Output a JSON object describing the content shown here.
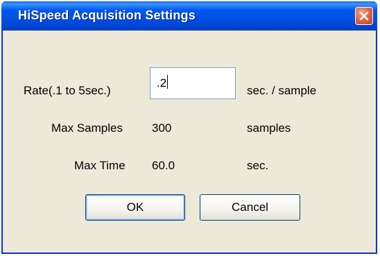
{
  "window": {
    "title": "HiSpeed Acquisition Settings",
    "close_icon": "close-icon"
  },
  "form": {
    "rate_label": "Rate(.1 to 5sec.)",
    "rate_value": ".2",
    "rate_unit": "sec. / sample",
    "max_samples_label": "Max Samples",
    "max_samples_value": "300",
    "max_samples_unit": "samples",
    "max_time_label": "Max Time",
    "max_time_value": "60.0",
    "max_time_unit": "sec."
  },
  "buttons": {
    "ok_label": "OK",
    "cancel_label": "Cancel"
  },
  "colors": {
    "titlebar": "#0054e3",
    "dialog_bg": "#ece9d8",
    "close_button": "#e06a45"
  }
}
